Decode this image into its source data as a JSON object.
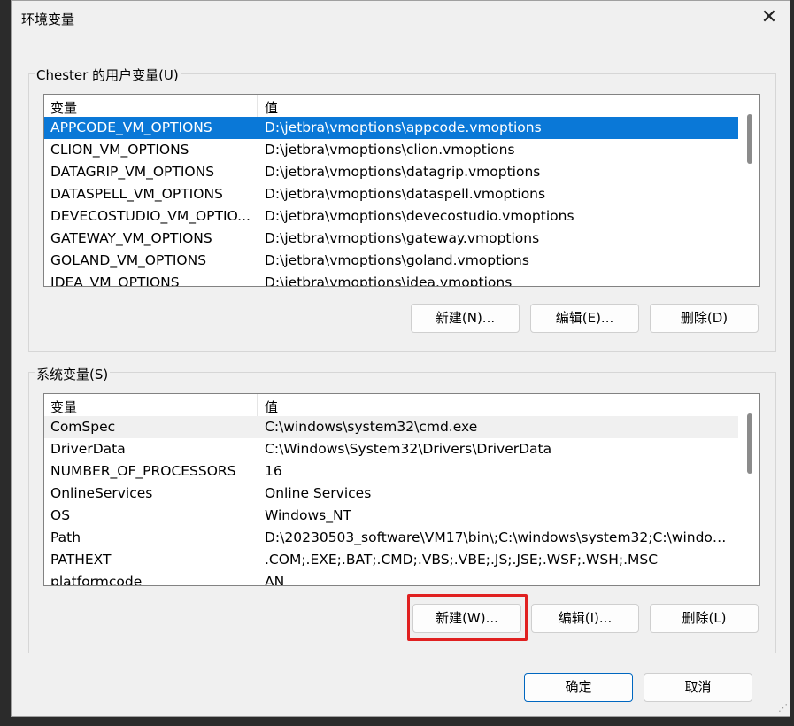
{
  "window": {
    "title": "环境变量",
    "close_icon": "close-icon"
  },
  "user_vars": {
    "label": "Chester 的用户变量(U)",
    "columns": [
      "变量",
      "值"
    ],
    "rows": [
      {
        "name": "APPCODE_VM_OPTIONS",
        "value": "D:\\jetbra\\vmoptions\\appcode.vmoptions"
      },
      {
        "name": "CLION_VM_OPTIONS",
        "value": "D:\\jetbra\\vmoptions\\clion.vmoptions"
      },
      {
        "name": "DATAGRIP_VM_OPTIONS",
        "value": "D:\\jetbra\\vmoptions\\datagrip.vmoptions"
      },
      {
        "name": "DATASPELL_VM_OPTIONS",
        "value": "D:\\jetbra\\vmoptions\\dataspell.vmoptions"
      },
      {
        "name": "DEVECOSTUDIO_VM_OPTIO...",
        "value": "D:\\jetbra\\vmoptions\\devecostudio.vmoptions"
      },
      {
        "name": "GATEWAY_VM_OPTIONS",
        "value": "D:\\jetbra\\vmoptions\\gateway.vmoptions"
      },
      {
        "name": "GOLAND_VM_OPTIONS",
        "value": "D:\\jetbra\\vmoptions\\goland.vmoptions"
      },
      {
        "name": "IDEA_VM_OPTIONS",
        "value": "D:\\jetbra\\vmoptions\\idea.vmoptions"
      }
    ],
    "buttons": {
      "new": "新建(N)...",
      "edit": "编辑(E)...",
      "delete": "删除(D)"
    }
  },
  "system_vars": {
    "label": "系统变量(S)",
    "columns": [
      "变量",
      "值"
    ],
    "rows": [
      {
        "name": "ComSpec",
        "value": "C:\\windows\\system32\\cmd.exe"
      },
      {
        "name": "DriverData",
        "value": "C:\\Windows\\System32\\Drivers\\DriverData"
      },
      {
        "name": "NUMBER_OF_PROCESSORS",
        "value": "16"
      },
      {
        "name": "OnlineServices",
        "value": "Online Services"
      },
      {
        "name": "OS",
        "value": "Windows_NT"
      },
      {
        "name": "Path",
        "value": "D:\\20230503_software\\VM17\\bin\\;C:\\windows\\system32;C:\\window..."
      },
      {
        "name": "PATHEXT",
        "value": ".COM;.EXE;.BAT;.CMD;.VBS;.VBE;.JS;.JSE;.WSF;.WSH;.MSC"
      },
      {
        "name": "platformcode",
        "value": "AN"
      }
    ],
    "buttons": {
      "new": "新建(W)...",
      "edit": "编辑(I)...",
      "delete": "删除(L)"
    }
  },
  "footer": {
    "ok": "确定",
    "cancel": "取消"
  },
  "colors": {
    "selection": "#0a78d7",
    "highlight_box": "#e02020",
    "primary_border": "#0067c0"
  }
}
